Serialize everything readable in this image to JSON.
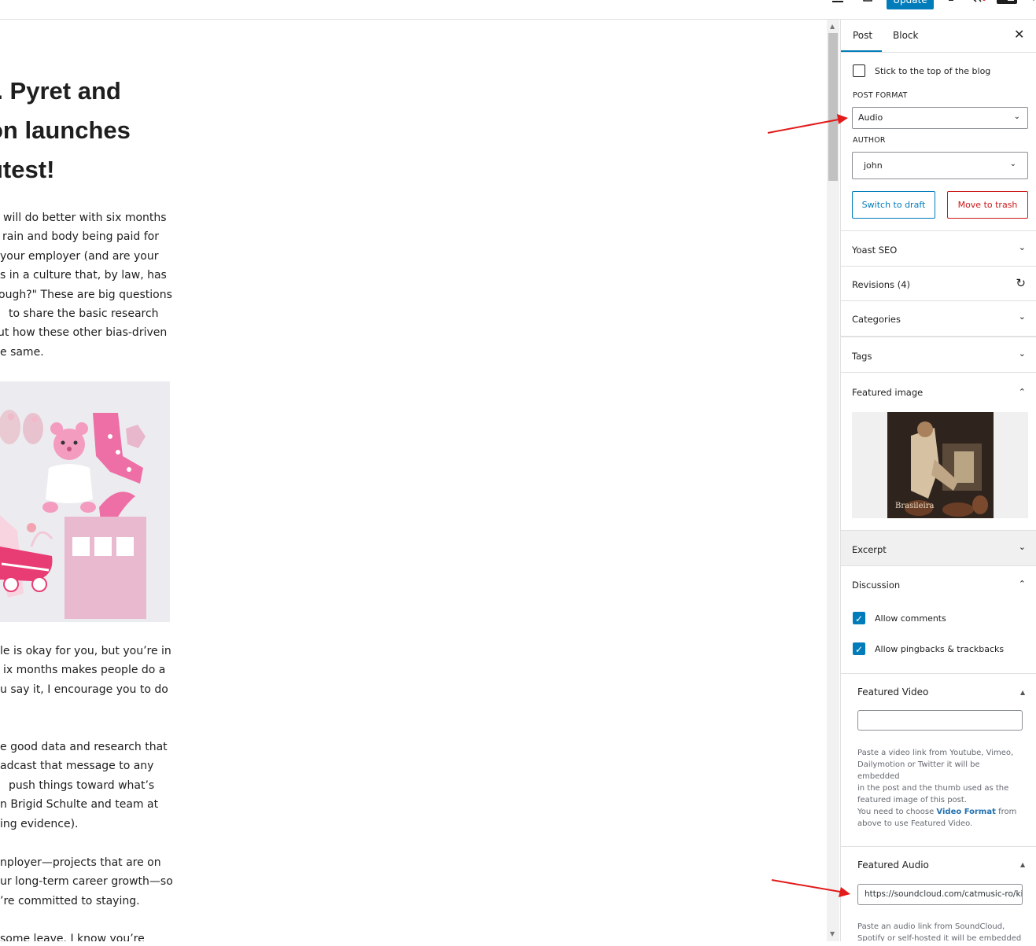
{
  "topbar": {
    "update_label": "Update"
  },
  "editor": {
    "title_lines": [
      "). Pyret and",
      "on launches",
      "utest!"
    ],
    "para1": [
      "will do better with six months",
      "rain and body being paid for",
      "your employer (and are your",
      "s in a culture that, by law, has",
      "ough?\" These are big questions",
      "to share the basic research",
      "ut how these other bias-driven",
      "e same."
    ],
    "para2": [
      "le is okay for you, but you’re in",
      "ix months makes people do a",
      "u say it, I encourage you to do"
    ],
    "para3": [
      "e good data and research that",
      "adcast that message to any",
      "push things toward what’s",
      "n Brigid Schulte and team at",
      "ing evidence)."
    ],
    "para4": [
      "nployer—projects that are on",
      "ur long-term career growth—so",
      "’re committed to staying."
    ],
    "para5": [
      "some leave. I know you’re"
    ]
  },
  "sidebar": {
    "tab_post": "Post",
    "tab_block": "Block",
    "close": "✕",
    "sticky_label": "Stick to the top of the blog",
    "post_format_label": "POST FORMAT",
    "post_format_value": "Audio",
    "author_label": "AUTHOR",
    "author_value": "john",
    "switch_draft": "Switch to draft",
    "move_trash": "Move to trash",
    "panels": {
      "yoast": "Yoast SEO",
      "revisions": "Revisions (4)",
      "categories": "Categories",
      "tags": "Tags",
      "featured_image": "Featured image",
      "excerpt": "Excerpt",
      "discussion": "Discussion"
    },
    "allow_comments": "Allow comments",
    "allow_pingbacks": "Allow pingbacks & trackbacks",
    "featured_video": {
      "title": "Featured Video",
      "value": "",
      "desc_lines": [
        "Paste a video link from Youtube, Vimeo,",
        "Dailymotion or Twitter it will be embedded",
        "in the post and the thumb used as the",
        "featured image of this post."
      ],
      "desc_pre": "You need to choose ",
      "desc_link": "Video Format",
      "desc_post": " from",
      "desc_last": "above to use Featured Video."
    },
    "featured_audio": {
      "title": "Featured Audio",
      "value": "https://soundcloud.com/catmusic-ro/kill",
      "desc_lines": [
        "Paste an audio link from SoundCloud,",
        "Spotify or self-hosted it will be embedded"
      ]
    }
  },
  "featured_image": {
    "caption_text": "Brasileira"
  },
  "colors": {
    "accent": "#007cba",
    "trash": "#cc1818",
    "annotation_arrow": "#e21b1b"
  }
}
